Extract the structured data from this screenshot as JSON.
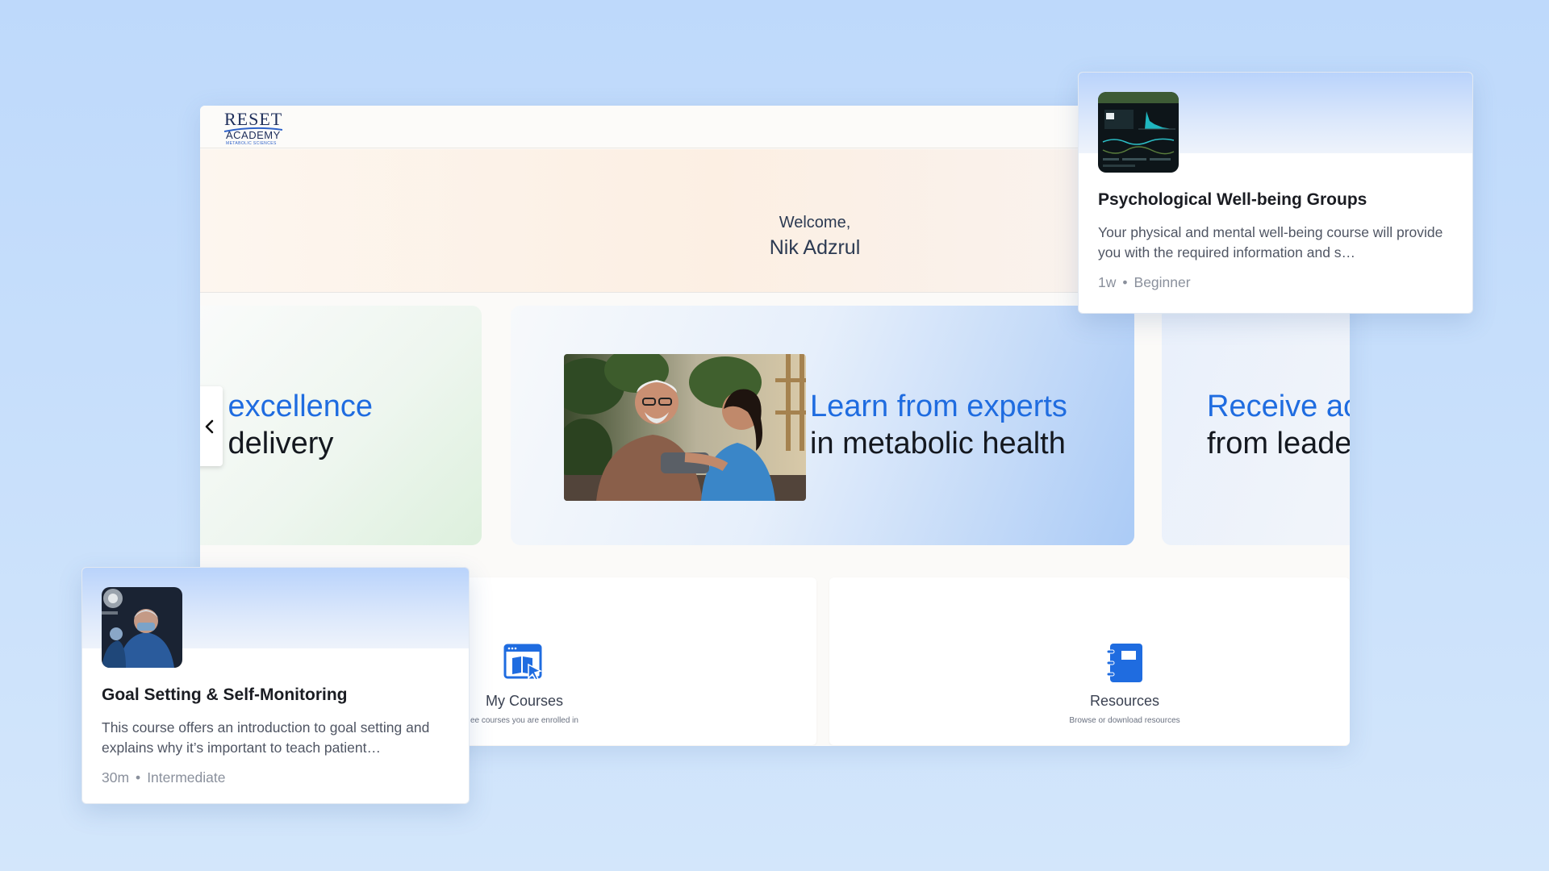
{
  "brand": {
    "logo_word": "RESET",
    "logo_sub": "ACADEMY",
    "logo_tagline": "METABOLIC SCIENCES",
    "accent_color": "#1f6ce0"
  },
  "welcome": {
    "greeting": "Welcome,",
    "name": "Nik Adzrul"
  },
  "carousel": {
    "prev_icon": "chevron-left-icon",
    "slides": [
      {
        "line1": "rsue excellence",
        "line2": "care delivery"
      },
      {
        "line1": "Learn from experts",
        "line2": "in metabolic health"
      },
      {
        "line1": "Receive ac",
        "line2": "from leade"
      }
    ]
  },
  "nav_cards": [
    {
      "title": "My Courses",
      "subtitle": "ee courses you are enrolled in",
      "icon": "course-browser-icon"
    },
    {
      "title": "Resources",
      "subtitle": "Browse or download resources",
      "icon": "notebook-icon"
    }
  ],
  "course_cards": [
    {
      "title": "Psychological Well-being Groups",
      "description": "Your physical and mental well-being course will provide you with the required information and s…",
      "duration": "1w",
      "level": "Beginner",
      "thumb_icon": "dashboard-thumbnail"
    },
    {
      "title": "Goal Setting & Self-Monitoring",
      "description": "This course offers an introduction to goal setting and explains why it’s important to teach patient…",
      "duration": "30m",
      "level": "Intermediate",
      "thumb_icon": "surgeon-thumbnail"
    }
  ],
  "separator": "•"
}
